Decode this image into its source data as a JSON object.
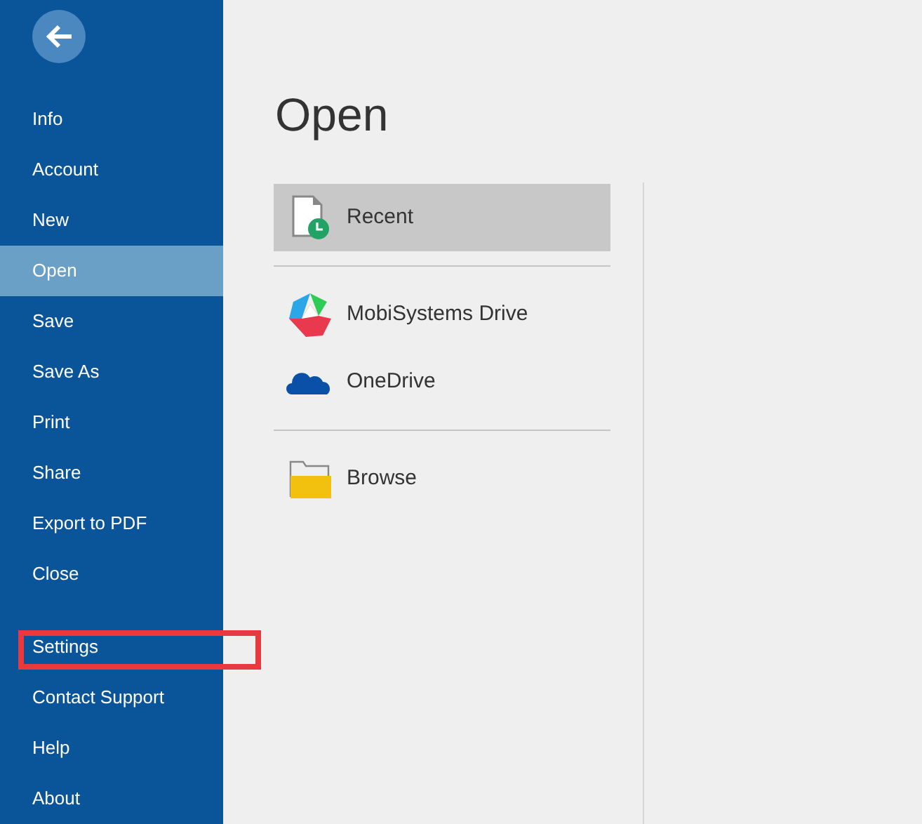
{
  "sidebar": {
    "items": [
      {
        "label": "Info",
        "selected": false,
        "outlined": false
      },
      {
        "label": "Account",
        "selected": false,
        "outlined": false
      },
      {
        "label": "New",
        "selected": false,
        "outlined": false
      },
      {
        "label": "Open",
        "selected": true,
        "outlined": false
      },
      {
        "label": "Save",
        "selected": false,
        "outlined": false
      },
      {
        "label": "Save As",
        "selected": false,
        "outlined": false
      },
      {
        "label": "Print",
        "selected": false,
        "outlined": false
      },
      {
        "label": "Share",
        "selected": false,
        "outlined": false
      },
      {
        "label": "Export to PDF",
        "selected": false,
        "outlined": false
      },
      {
        "label": "Close",
        "selected": false,
        "outlined": false
      }
    ],
    "bottom_items": [
      {
        "label": "Settings",
        "selected": false,
        "outlined": true
      },
      {
        "label": "Contact Support",
        "selected": false,
        "outlined": false
      },
      {
        "label": "Help",
        "selected": false,
        "outlined": false
      },
      {
        "label": "About",
        "selected": false,
        "outlined": false
      }
    ]
  },
  "title": "Open",
  "location_groups": [
    [
      {
        "label": "Recent",
        "kind": "recent",
        "selected": true
      }
    ],
    [
      {
        "label": "MobiSystems Drive",
        "kind": "drive",
        "selected": false
      },
      {
        "label": "OneDrive",
        "kind": "cloud",
        "selected": false
      }
    ],
    [
      {
        "label": "Browse",
        "kind": "folder",
        "selected": false
      }
    ]
  ]
}
